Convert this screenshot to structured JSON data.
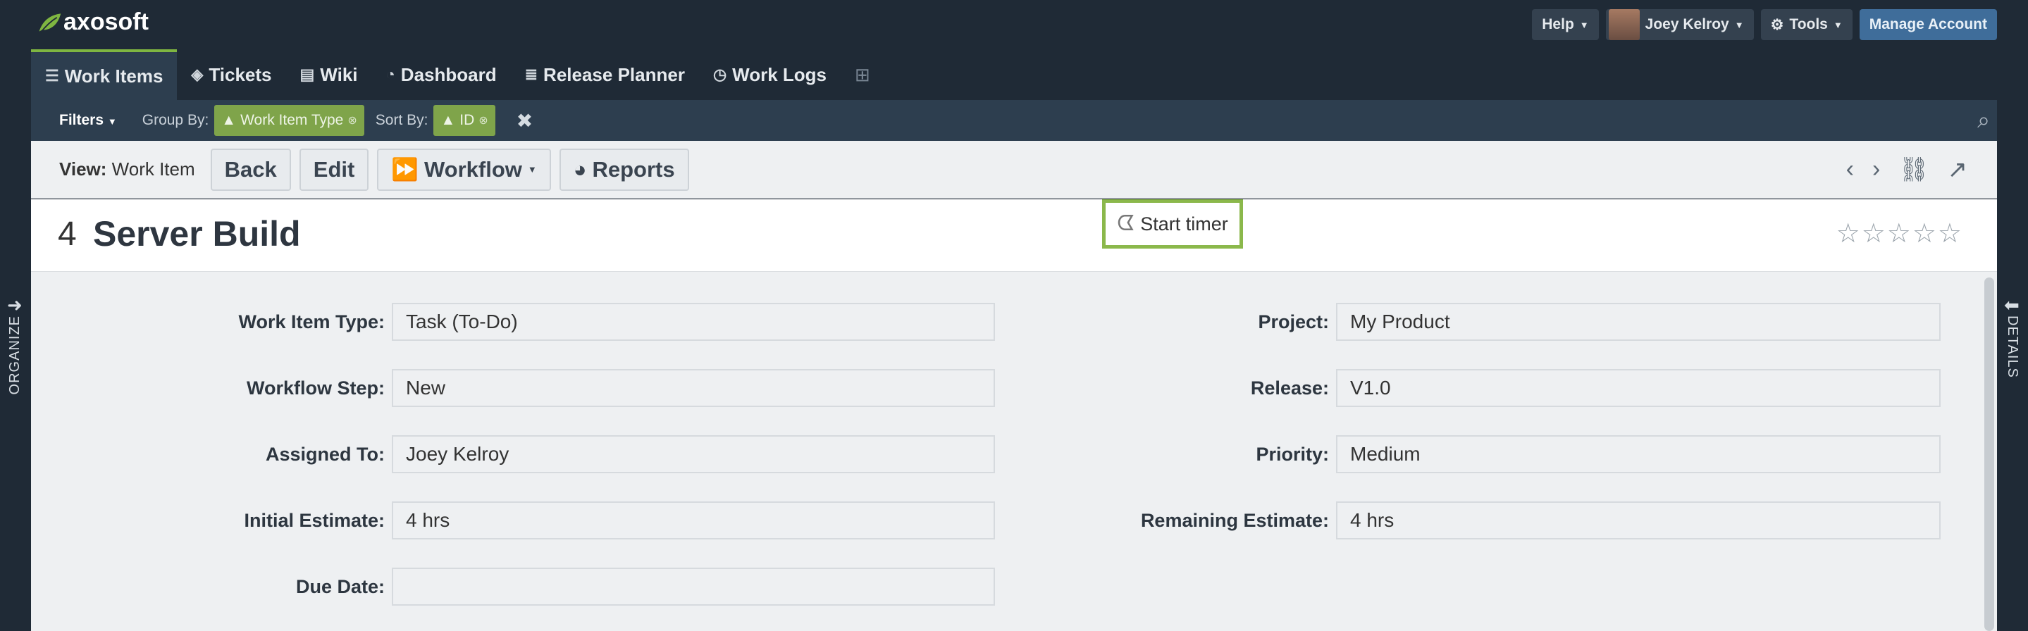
{
  "brand": {
    "name": "axosoft"
  },
  "top_actions": {
    "help": "Help",
    "user": "Joey Kelroy",
    "tools": "Tools",
    "manage": "Manage Account"
  },
  "nav": {
    "tabs": [
      {
        "label": "Work Items",
        "icon": "list-icon"
      },
      {
        "label": "Tickets",
        "icon": "ticket-icon"
      },
      {
        "label": "Wiki",
        "icon": "document-icon"
      },
      {
        "label": "Dashboard",
        "icon": "dashboard-icon"
      },
      {
        "label": "Release Planner",
        "icon": "planner-icon"
      },
      {
        "label": "Work Logs",
        "icon": "clock-icon"
      }
    ]
  },
  "filters": {
    "filters_label": "Filters",
    "group_by_label": "Group By:",
    "group_by_value": "Work Item Type",
    "sort_by_label": "Sort By:",
    "sort_by_value": "ID"
  },
  "toolbar": {
    "view_label": "View:",
    "view_value": "Work Item",
    "back": "Back",
    "edit": "Edit",
    "workflow": "Workflow",
    "reports": "Reports"
  },
  "rails": {
    "left": "ORGANIZE",
    "right": "DETAILS"
  },
  "item": {
    "id": "4",
    "title": "Server Build",
    "timer_label": "Start timer",
    "rating_stars": 0
  },
  "fields_left": [
    {
      "label": "Work Item Type:",
      "value": "Task (To-Do)"
    },
    {
      "label": "Workflow Step:",
      "value": "New"
    },
    {
      "label": "Assigned To:",
      "value": "Joey Kelroy"
    },
    {
      "label": "Initial Estimate:",
      "value": "4 hrs"
    },
    {
      "label": "Due Date:",
      "value": ""
    }
  ],
  "fields_right": [
    {
      "label": "Project:",
      "value": "My Product"
    },
    {
      "label": "Release:",
      "value": "V1.0"
    },
    {
      "label": "Priority:",
      "value": "Medium"
    },
    {
      "label": "Remaining Estimate:",
      "value": "4 hrs"
    }
  ]
}
